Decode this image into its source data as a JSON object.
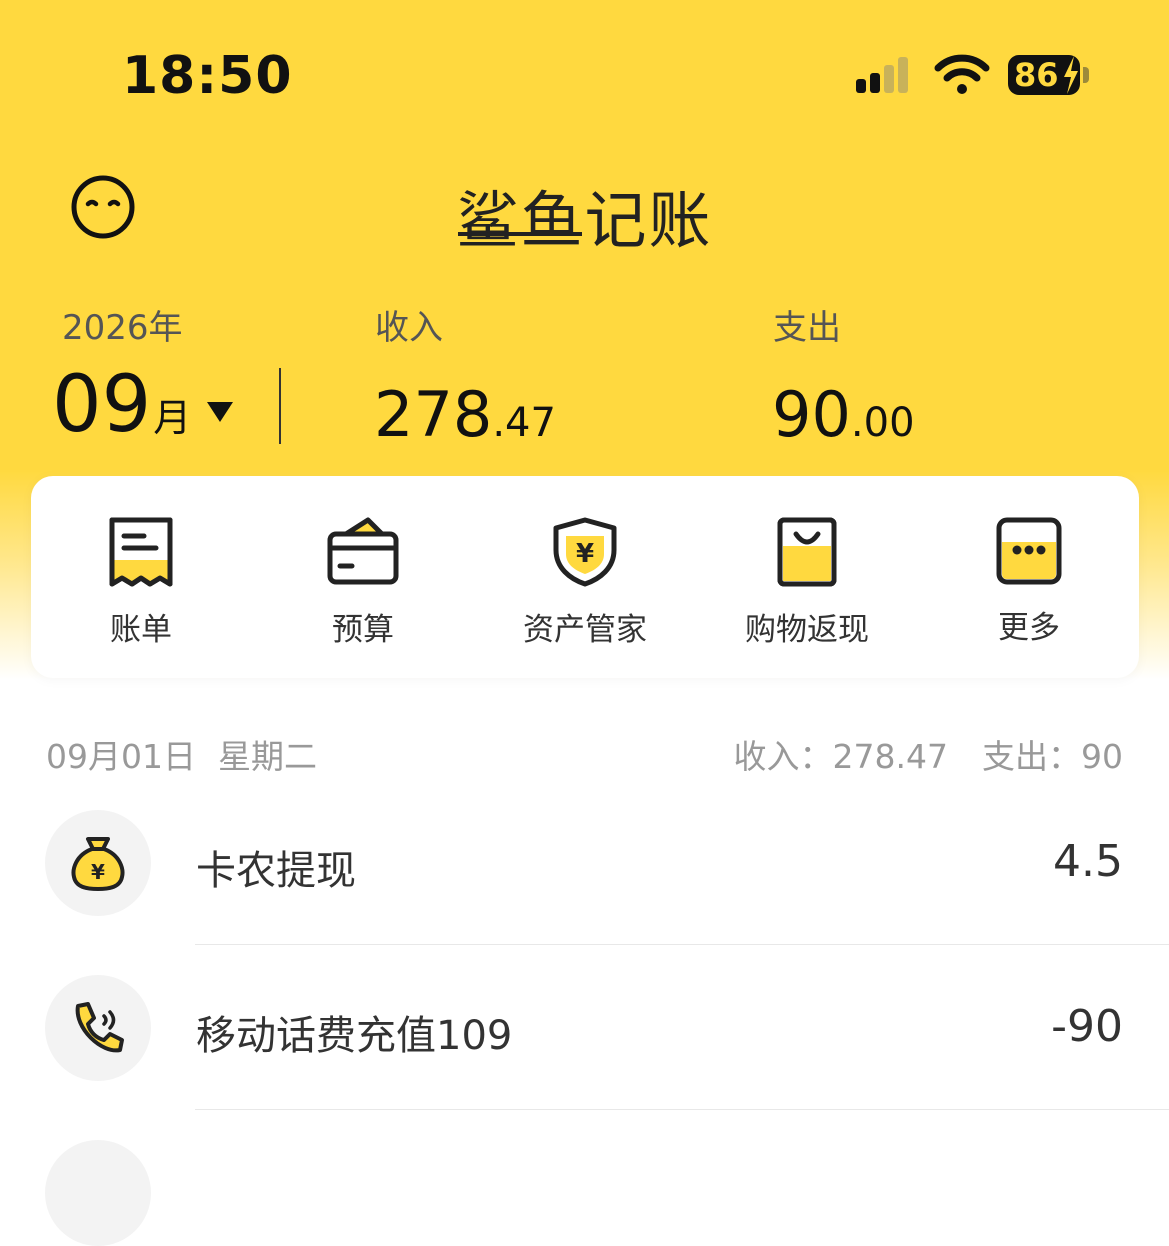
{
  "status_bar": {
    "time": "18:50",
    "battery": "86"
  },
  "header": {
    "title": "鲨鱼记账"
  },
  "summary": {
    "year": "2026年",
    "month": "09",
    "month_unit": "月",
    "income_label": "收入",
    "income_int": "278",
    "income_dec": ".47",
    "expense_label": "支出",
    "expense_int": "90",
    "expense_dec": ".00"
  },
  "actions": [
    {
      "label": "账单",
      "icon": "bill-icon"
    },
    {
      "label": "预算",
      "icon": "budget-wallet-icon"
    },
    {
      "label": "资产管家",
      "icon": "asset-shield-icon"
    },
    {
      "label": "购物返现",
      "icon": "shopping-bag-icon"
    },
    {
      "label": "更多",
      "icon": "more-icon"
    }
  ],
  "day": {
    "date": "09月01日",
    "weekday": "星期二",
    "income_label": "收入：",
    "income": "278.47",
    "expense_label": "支出：",
    "expense": "90"
  },
  "records": [
    {
      "name": "卡农提现",
      "amount": "4.5",
      "icon": "money-bag-icon"
    },
    {
      "name": "移动话费充值109",
      "amount": "-90",
      "icon": "phone-call-icon"
    }
  ],
  "colors": {
    "accent": "#FFD93F",
    "text": "#222222",
    "muted": "#999999"
  }
}
